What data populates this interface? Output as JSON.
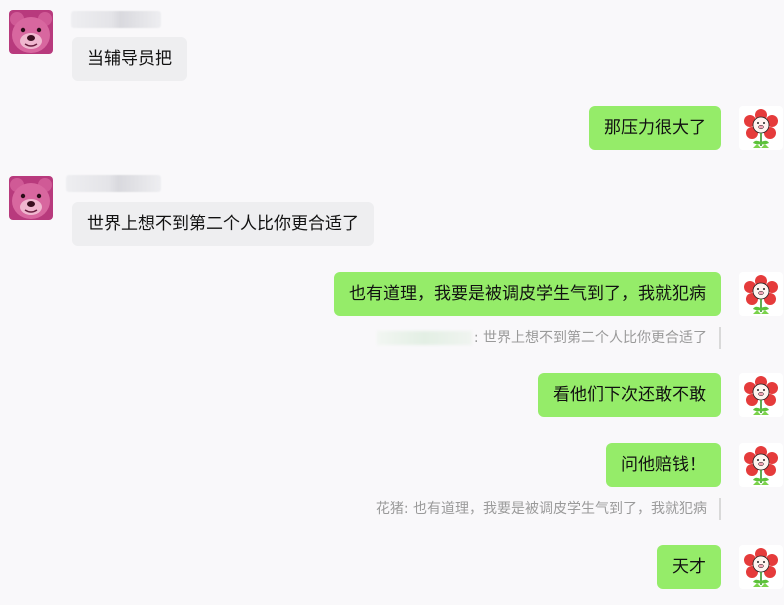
{
  "messages": [
    {
      "side": "left",
      "sender": "bear",
      "text": "当辅导员把"
    },
    {
      "side": "right",
      "sender": "flower",
      "text": "那压力很大了"
    },
    {
      "side": "left",
      "sender": "bear",
      "text": "世界上想不到第二个人比你更合适了"
    },
    {
      "side": "right",
      "sender": "flower",
      "text": "也有道理，我要是被调皮学生气到了，我就犯病"
    },
    {
      "side": "right",
      "sender": "flower",
      "text": "看他们下次还敢不敢"
    },
    {
      "side": "right",
      "sender": "flower",
      "text": "问他赔钱！"
    },
    {
      "side": "right",
      "sender": "flower",
      "text": "天才"
    }
  ],
  "quotes": [
    {
      "name_prefix": "",
      "text": ": 世界上想不到第二个人比你更合适了"
    },
    {
      "name_prefix": "花猪",
      "text": "花猪: 也有道理，我要是被调皮学生气到了，我就犯病"
    }
  ],
  "colors": {
    "background": "#f9f8fa",
    "bubble_self": "#95ec69",
    "bubble_other": "#eeeef0",
    "quote_text": "#9a9a9a"
  },
  "icons": {
    "left_avatar": "pink-bear-avatar",
    "right_avatar": "red-flower-pig-avatar"
  }
}
